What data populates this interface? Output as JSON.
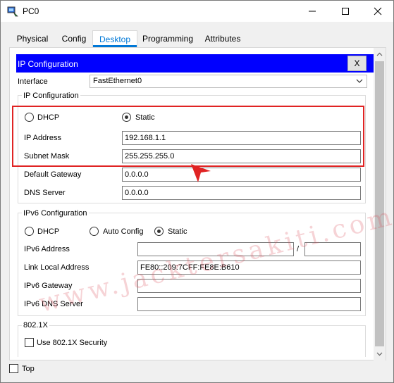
{
  "window": {
    "title": "PC0"
  },
  "tabs": [
    {
      "label": "Physical"
    },
    {
      "label": "Config"
    },
    {
      "label": "Desktop"
    },
    {
      "label": "Programming"
    },
    {
      "label": "Attributes"
    }
  ],
  "active_tab": "Desktop",
  "panel": {
    "title": "IP Configuration",
    "close_label": "X",
    "interface_label": "Interface",
    "interface_value": "FastEthernet0"
  },
  "ipv4": {
    "group_title": "IP Configuration",
    "dhcp_label": "DHCP",
    "static_label": "Static",
    "selected_mode": "Static",
    "ip_label": "IP Address",
    "ip_value": "192.168.1.1",
    "mask_label": "Subnet Mask",
    "mask_value": "255.255.255.0",
    "gateway_label": "Default Gateway",
    "gateway_value": "0.0.0.0",
    "dns_label": "DNS Server",
    "dns_value": "0.0.0.0"
  },
  "ipv6": {
    "group_title": "IPv6 Configuration",
    "dhcp_label": "DHCP",
    "auto_label": "Auto Config",
    "static_label": "Static",
    "selected_mode": "Static",
    "address_label": "IPv6 Address",
    "address_value": "",
    "prefix_separator": "/",
    "prefix_value": "",
    "link_local_label": "Link Local Address",
    "link_local_value": "FE80::209:7CFF:FE8E:B610",
    "gateway_label": "IPv6 Gateway",
    "gateway_value": "",
    "dns_label": "IPv6 DNS Server",
    "dns_value": ""
  },
  "dot1x": {
    "group_title": "802.1X",
    "use_label": "Use 802.1X Security",
    "checked": false
  },
  "footer": {
    "top_label": "Top",
    "top_checked": false
  },
  "watermark": "www.jacktersakiti.com",
  "colors": {
    "accent": "#0078d7",
    "panel_header": "#0000ff",
    "highlight": "#e02323"
  }
}
